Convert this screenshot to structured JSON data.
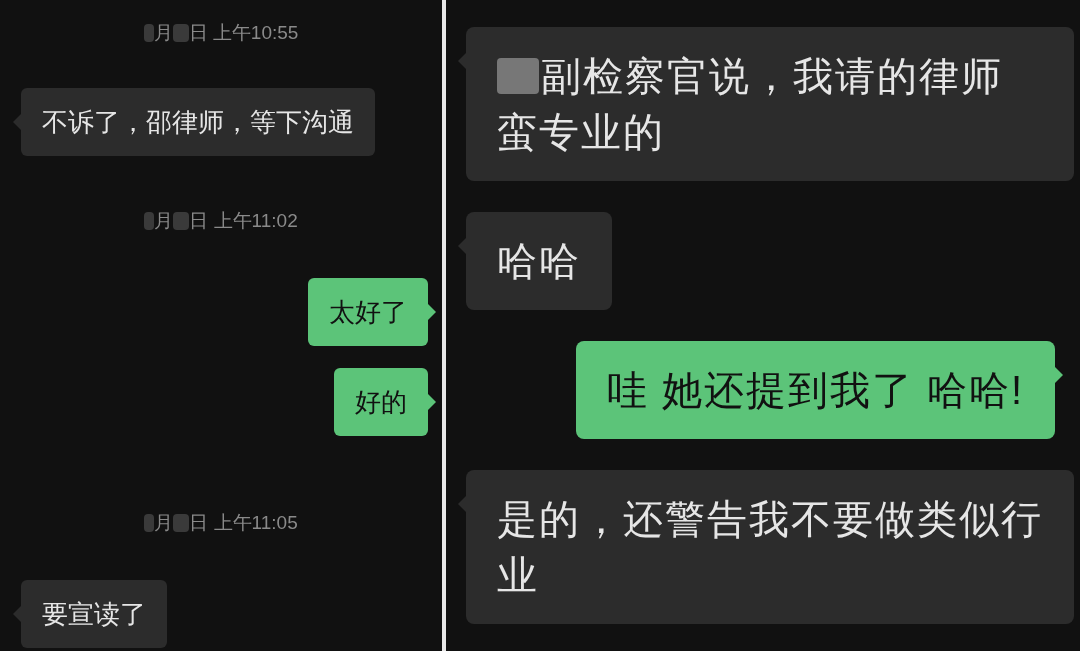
{
  "panels": [
    {
      "messages": [
        {
          "kind": "time",
          "parts": [
            "月",
            "日 上午10:55"
          ]
        },
        {
          "kind": "received",
          "text": "不诉了，邵律师，等下沟通",
          "redacted": false
        },
        {
          "kind": "time",
          "parts": [
            "月",
            "日 上午11:02"
          ]
        },
        {
          "kind": "sent",
          "text": "太好了",
          "redacted": false
        },
        {
          "kind": "sent",
          "text": "好的",
          "redacted": false
        },
        {
          "kind": "time",
          "parts": [
            "月",
            "日 上午11:05"
          ]
        },
        {
          "kind": "received",
          "text": "要宣读了",
          "redacted": false
        }
      ]
    },
    {
      "messages": [
        {
          "kind": "received",
          "text": "副检察官说，我请的律师蛮专业的",
          "redacted": true
        },
        {
          "kind": "received",
          "text": "哈哈",
          "redacted": false
        },
        {
          "kind": "sent",
          "text": "哇 她还提到我了 哈哈!",
          "redacted": false
        },
        {
          "kind": "received",
          "text": "是的，还警告我不要做类似行业",
          "redacted": false
        }
      ]
    }
  ]
}
